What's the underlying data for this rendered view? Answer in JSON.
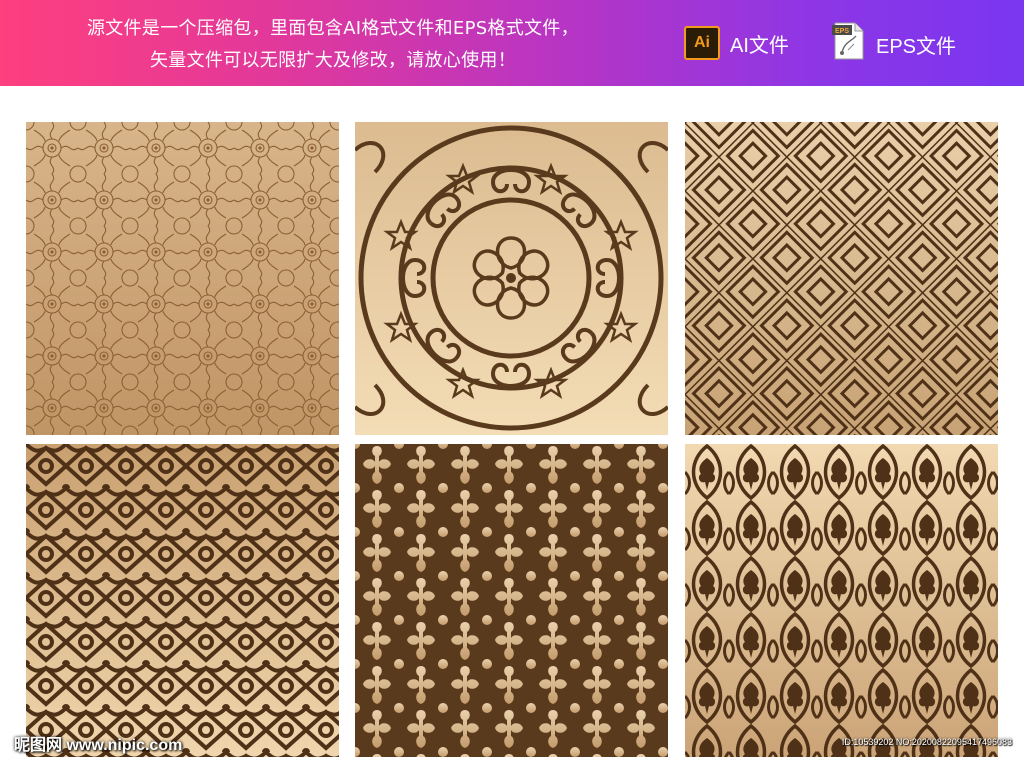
{
  "banner": {
    "line1": "源文件是一个压缩包，里面包含AI格式文件和EPS格式文件，",
    "line2": "矢量文件可以无限扩大及修改，请放心使用！",
    "ai_icon_text": "Ai",
    "ai_label": "AI文件",
    "eps_icon_text": "EPS",
    "eps_label": "EPS文件",
    "gradient_start": "#ff3f7e",
    "gradient_end": "#7a36f0"
  },
  "patterns": {
    "gold_light": "#f0d3a4",
    "gold_dark": "#b7895a",
    "ink": "#5c3a1a",
    "tiles": [
      "ornate-lace-pattern",
      "medallion-flower-pattern",
      "diamond-lattice-pattern",
      "arabesque-pattern",
      "fleur-cross-pattern",
      "ogee-leaf-pattern"
    ]
  },
  "watermark": {
    "left": "昵图网 www.nipic.com",
    "right": "ID:10539202 NO:20200822095417496083"
  }
}
